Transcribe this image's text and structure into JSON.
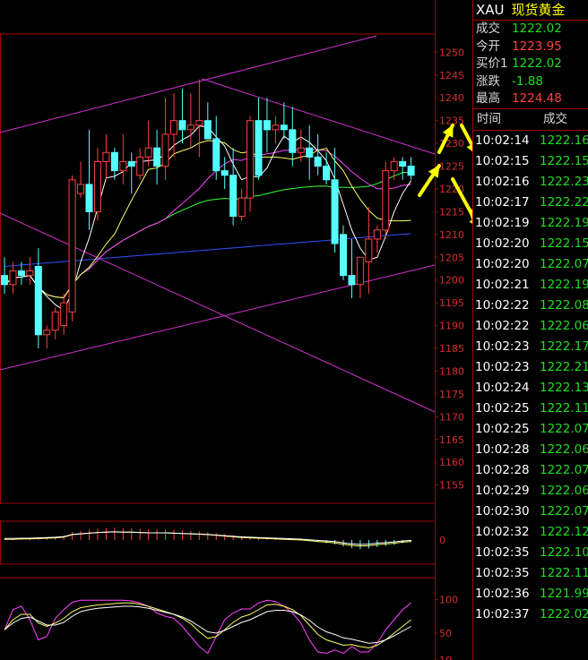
{
  "quote": {
    "symbol": "XAU",
    "name": "现货黄金",
    "rows": [
      {
        "label": "成交",
        "value": "1222.02",
        "dir": "dn"
      },
      {
        "label": "今开",
        "value": "1223.95",
        "dir": "up"
      },
      {
        "label": "买价1",
        "value": "1222.02",
        "dir": "dn"
      },
      {
        "label": "涨跌",
        "value": "-1.88",
        "dir": "dn"
      },
      {
        "label": "最高",
        "value": "1224.48",
        "dir": "up"
      }
    ]
  },
  "ticks": {
    "header_time": "时间",
    "header_price": "成交",
    "rows": [
      {
        "time": "10:02:14",
        "price": "1222.16"
      },
      {
        "time": "10:02:15",
        "price": "1222.15"
      },
      {
        "time": "10:02:16",
        "price": "1222.23"
      },
      {
        "time": "10:02:17",
        "price": "1222.22"
      },
      {
        "time": "10:02:19",
        "price": "1222.19"
      },
      {
        "time": "10:02:20",
        "price": "1222.15"
      },
      {
        "time": "10:02:20",
        "price": "1222.07"
      },
      {
        "time": "10:02:21",
        "price": "1222.19"
      },
      {
        "time": "10:02:22",
        "price": "1222.08"
      },
      {
        "time": "10:02:22",
        "price": "1222.06"
      },
      {
        "time": "10:02:23",
        "price": "1222.17"
      },
      {
        "time": "10:02:23",
        "price": "1222.21"
      },
      {
        "time": "10:02:24",
        "price": "1222.13"
      },
      {
        "time": "10:02:25",
        "price": "1222.11"
      },
      {
        "time": "10:02:25",
        "price": "1222.07"
      },
      {
        "time": "10:02:28",
        "price": "1222.06"
      },
      {
        "time": "10:02:28",
        "price": "1222.07"
      },
      {
        "time": "10:02:29",
        "price": "1222.06"
      },
      {
        "time": "10:02:30",
        "price": "1222.07"
      },
      {
        "time": "10:02:32",
        "price": "1222.12"
      },
      {
        "time": "10:02:35",
        "price": "1222.10"
      },
      {
        "time": "10:02:35",
        "price": "1222.11"
      },
      {
        "time": "10:02:36",
        "price": "1221.99"
      },
      {
        "time": "10:02:37",
        "price": "1222.02"
      }
    ]
  },
  "colors": {
    "bg": "#000000",
    "up": "#ff4040",
    "down": "#55ffff",
    "grid": "#a00000",
    "ma5": "#ffffff",
    "ma10": "#ffff66",
    "ma20": "#ff44ff",
    "ma40": "#33ff33",
    "ma60": "#3050ff",
    "trend": "#d030d0",
    "arrow": "#ffff00"
  },
  "chart_data": [
    {
      "type": "candlestick",
      "ylim": [
        1151,
        1254
      ],
      "y_ticks": [
        1250,
        1245,
        1240,
        1235,
        1230,
        1225,
        1220,
        1215,
        1210,
        1205,
        1200,
        1195,
        1190,
        1185,
        1180,
        1175,
        1170,
        1165,
        1160,
        1155
      ],
      "candles": [
        [
          1201,
          1205,
          1197,
          1199
        ],
        [
          1199,
          1204,
          1197,
          1202
        ],
        [
          1202,
          1204,
          1199,
          1201
        ],
        [
          1201,
          1205,
          1199,
          1202
        ],
        [
          1203,
          1207,
          1185,
          1188
        ],
        [
          1188,
          1190,
          1185,
          1189
        ],
        [
          1189,
          1194,
          1187,
          1193
        ],
        [
          1190,
          1197,
          1188,
          1195
        ],
        [
          1193,
          1223,
          1191,
          1222
        ],
        [
          1219,
          1226,
          1218,
          1221
        ],
        [
          1221,
          1233,
          1211,
          1215
        ],
        [
          1215,
          1229,
          1213,
          1226
        ],
        [
          1226,
          1232,
          1222,
          1228
        ],
        [
          1228,
          1229,
          1222,
          1224
        ],
        [
          1224,
          1232,
          1221,
          1226
        ],
        [
          1226,
          1228,
          1219,
          1225
        ],
        [
          1223,
          1229,
          1222,
          1227
        ],
        [
          1227,
          1235,
          1225,
          1229
        ],
        [
          1229,
          1233,
          1221,
          1225
        ],
        [
          1225,
          1240,
          1222,
          1232
        ],
        [
          1232,
          1241,
          1227,
          1235
        ],
        [
          1235,
          1242,
          1230,
          1233
        ],
        [
          1233,
          1241,
          1229,
          1234
        ],
        [
          1234,
          1244,
          1227,
          1235
        ],
        [
          1235,
          1239,
          1231,
          1231
        ],
        [
          1231,
          1236,
          1222,
          1224
        ],
        [
          1224,
          1227,
          1220,
          1223
        ],
        [
          1223,
          1229,
          1212,
          1214
        ],
        [
          1214,
          1220,
          1213,
          1218
        ],
        [
          1218,
          1236,
          1215,
          1235
        ],
        [
          1235,
          1240,
          1222,
          1223
        ],
        [
          1235,
          1240,
          1228,
          1233
        ],
        [
          1233,
          1236,
          1230,
          1234
        ],
        [
          1234,
          1239,
          1231,
          1233
        ],
        [
          1233,
          1238,
          1225,
          1228
        ],
        [
          1228,
          1233,
          1226,
          1229
        ],
        [
          1229,
          1234,
          1222,
          1227
        ],
        [
          1227,
          1232,
          1223,
          1225
        ],
        [
          1225,
          1228,
          1221,
          1222
        ],
        [
          1222,
          1229,
          1206,
          1208
        ],
        [
          1210,
          1212,
          1200,
          1201
        ],
        [
          1201,
          1209,
          1196,
          1199
        ],
        [
          1199,
          1204,
          1196,
          1205
        ],
        [
          1204,
          1216,
          1197,
          1209
        ],
        [
          1209,
          1212,
          1206,
          1211
        ],
        [
          1211,
          1226,
          1209,
          1224
        ],
        [
          1224,
          1227,
          1222,
          1226
        ],
        [
          1226,
          1227,
          1222,
          1225
        ],
        [
          1225,
          1227,
          1222,
          1223
        ]
      ]
    },
    {
      "type": "bar",
      "y_ticks": [
        0
      ],
      "values": [
        0.2,
        0.2,
        0.3,
        0.3,
        0.4,
        0.5,
        0.6,
        0.8,
        1.5,
        1.7,
        1.9,
        2.1,
        2.2,
        2.3,
        2.2,
        2.2,
        2.1,
        2.0,
        2.0,
        2.0,
        1.9,
        1.8,
        1.7,
        1.6,
        1.5,
        1.3,
        1.1,
        0.9,
        0.7,
        0.6,
        0.5,
        0.4,
        0.3,
        0.2,
        0.1,
        0.0,
        -0.2,
        -0.4,
        -0.6,
        -0.8,
        -1.2,
        -1.5,
        -1.7,
        -1.6,
        -1.3,
        -1.1,
        -0.9,
        -0.6,
        -0.4
      ]
    },
    {
      "type": "line",
      "y_ticks": [
        100,
        50,
        10
      ],
      "ylim": [
        10,
        110
      ],
      "series": [
        {
          "color": "#ff44ff",
          "values": [
            55,
            85,
            90,
            70,
            40,
            45,
            72,
            85,
            96,
            99,
            99,
            99,
            99,
            99,
            99,
            98,
            95,
            90,
            80,
            75,
            72,
            60,
            45,
            30,
            20,
            45,
            70,
            80,
            86,
            86,
            95,
            99,
            97,
            90,
            80,
            65,
            40,
            22,
            20,
            25,
            20,
            30,
            22,
            22,
            35,
            55,
            70,
            85,
            95
          ]
        },
        {
          "color": "#ffff66",
          "values": [
            55,
            70,
            78,
            78,
            65,
            60,
            65,
            72,
            82,
            88,
            90,
            92,
            93,
            94,
            95,
            95,
            93,
            90,
            86,
            82,
            78,
            72,
            64,
            52,
            42,
            45,
            55,
            66,
            74,
            78,
            85,
            92,
            93,
            90,
            85,
            76,
            62,
            48,
            40,
            36,
            32,
            33,
            30,
            28,
            32,
            40,
            50,
            60,
            70
          ]
        },
        {
          "color": "#ffffff",
          "values": [
            55,
            65,
            72,
            74,
            68,
            62,
            62,
            66,
            75,
            82,
            85,
            87,
            88,
            89,
            90,
            90,
            89,
            87,
            84,
            81,
            78,
            74,
            68,
            60,
            52,
            50,
            54,
            60,
            66,
            70,
            76,
            82,
            84,
            84,
            82,
            77,
            69,
            59,
            52,
            48,
            43,
            41,
            38,
            35,
            36,
            40,
            46,
            53,
            60
          ]
        }
      ]
    }
  ]
}
